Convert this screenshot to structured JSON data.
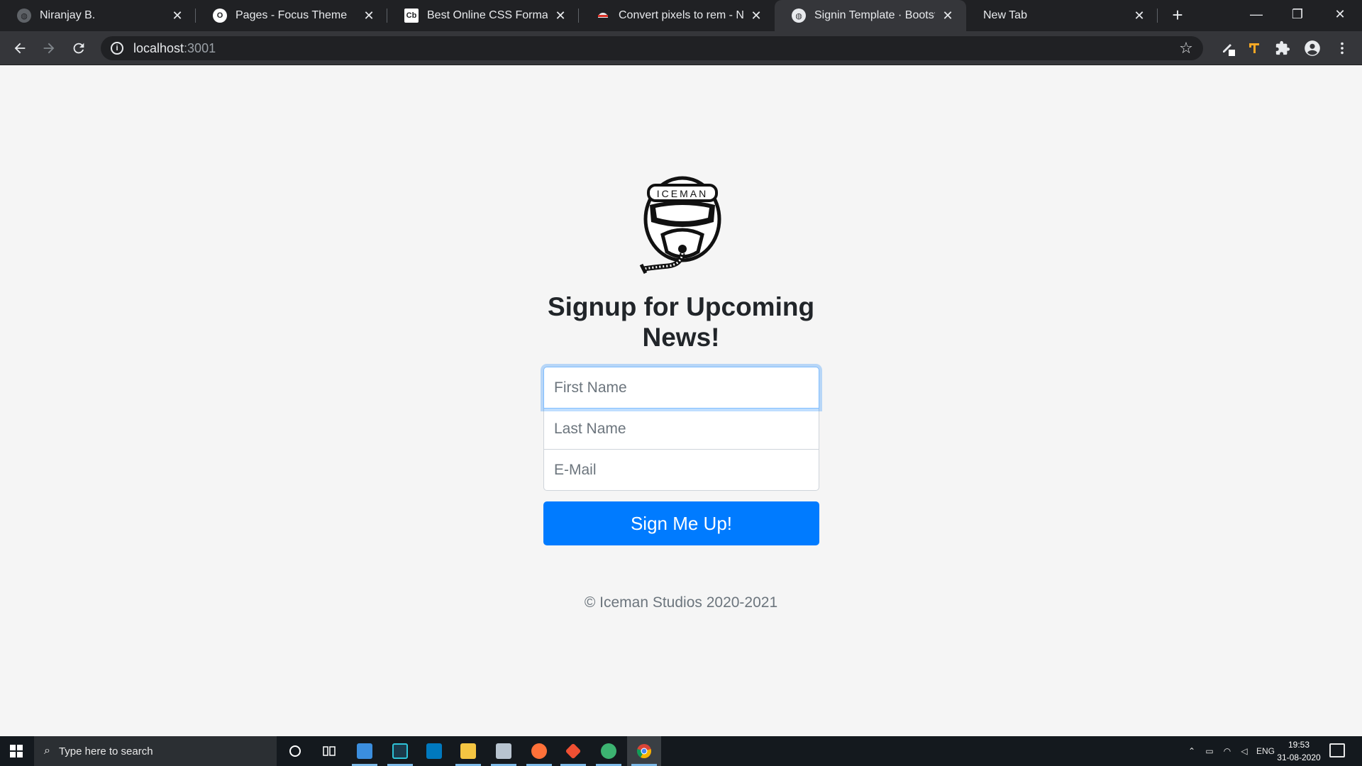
{
  "browser": {
    "tabs": [
      {
        "title": "Niranjay B.",
        "favicon": "globe-icon",
        "active": false
      },
      {
        "title": "Pages - Focus Theme",
        "favicon": "circle-o-icon",
        "active": false
      },
      {
        "title": "Best Online CSS Formatter",
        "favicon": "cb-icon",
        "active": false
      },
      {
        "title": "Convert pixels to rem - Nin",
        "favicon": "ninja-icon",
        "active": false
      },
      {
        "title": "Signin Template · Bootstrap",
        "favicon": "globe-icon",
        "active": true
      },
      {
        "title": "New Tab",
        "favicon": "",
        "active": false
      }
    ],
    "new_tab_label": "+",
    "url_host": "localhost",
    "url_port": ":3001",
    "info_label": "i"
  },
  "page": {
    "logo_text": "ICEMAN",
    "heading": "Signup for Upcoming News!",
    "first_name_placeholder": "First Name",
    "last_name_placeholder": "Last Name",
    "email_placeholder": "E-Mail",
    "submit_label": "Sign Me Up!",
    "footer": "© Iceman Studios 2020-2021",
    "accent_color": "#007bff"
  },
  "taskbar": {
    "search_placeholder": "Type here to search",
    "language": "ENG",
    "time": "19:53",
    "date": "31-08-2020",
    "apps": [
      "cortana-icon",
      "task-view-icon",
      "vscode-icon",
      "predator-icon",
      "trello-icon",
      "file-explorer-icon",
      "mail-icon",
      "firefox-icon",
      "git-icon",
      "gps-icon",
      "chrome-icon"
    ]
  }
}
